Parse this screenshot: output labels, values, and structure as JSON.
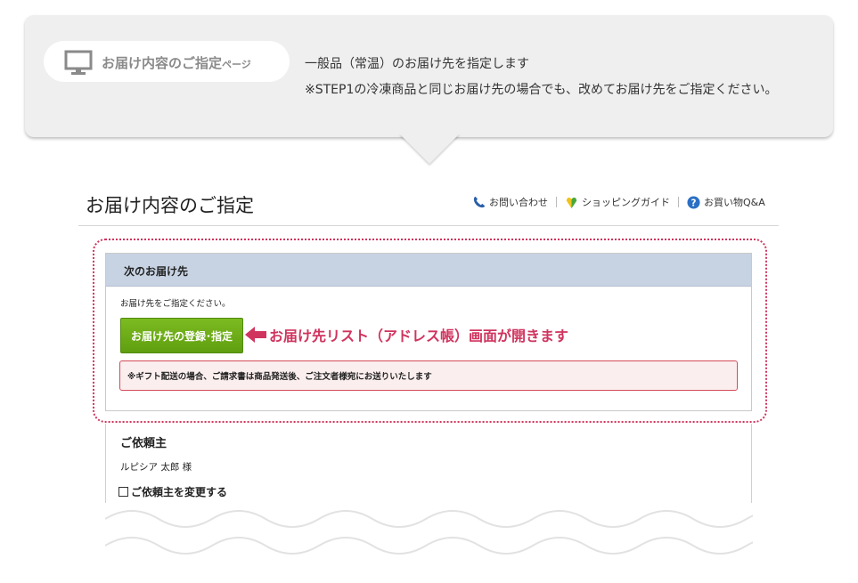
{
  "callout": {
    "page_label_main": "お届け内容のご指定",
    "page_label_suffix": "ページ",
    "line1": "一般品（常温）のお届け先を指定します",
    "line2": "※STEP1の冷凍商品と同じお届け先の場合でも、改めてお届け先をご指定ください。",
    "icon": "monitor-icon"
  },
  "header": {
    "title": "お届け内容のご指定",
    "links": [
      {
        "label": "お問い合わせ",
        "icon": "phone-icon"
      },
      {
        "label": "ショッピングガイド",
        "icon": "leaf-icon"
      },
      {
        "label": "お買い物Q&A",
        "icon": "question-icon"
      }
    ]
  },
  "next_destination": {
    "heading": "次のお届け先",
    "prompt": "お届け先をご指定ください。",
    "button_label": "お届け先の登録･指定",
    "annotation": "お届け先リスト（アドレス帳）画面が開きます",
    "gift_notice": "※ギフト配送の場合、ご請求書は商品発送後、ご注文者様宛にお送りいたします"
  },
  "requester": {
    "heading": "ご依頼主",
    "name": "ルピシア 太郎 様",
    "change_label": "ご依頼主を変更する",
    "change_checked": false
  },
  "colors": {
    "accent_pink": "#d0345e",
    "button_green": "#6aab16",
    "header_blue": "#c7d3e3"
  }
}
